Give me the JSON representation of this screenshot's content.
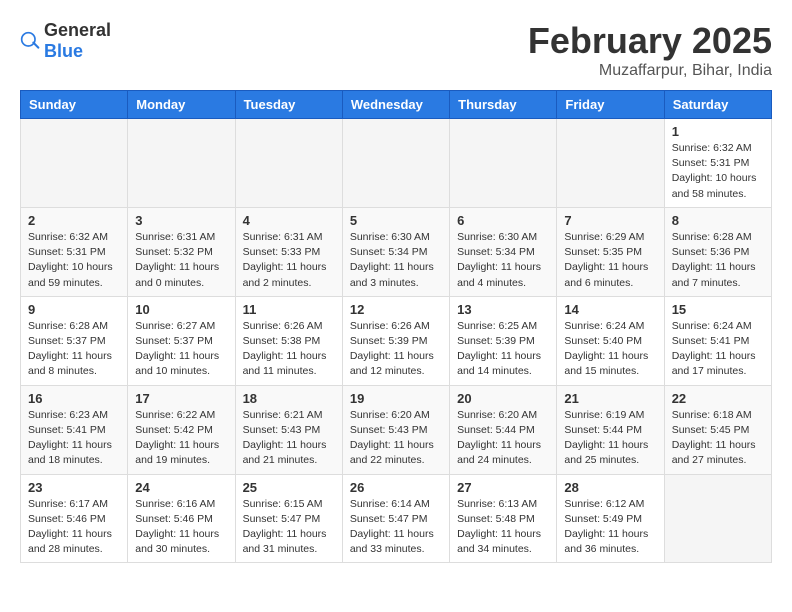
{
  "header": {
    "logo_general": "General",
    "logo_blue": "Blue",
    "title": "February 2025",
    "subtitle": "Muzaffarpur, Bihar, India"
  },
  "calendar": {
    "weekdays": [
      "Sunday",
      "Monday",
      "Tuesday",
      "Wednesday",
      "Thursday",
      "Friday",
      "Saturday"
    ],
    "weeks": [
      [
        {
          "day": "",
          "info": ""
        },
        {
          "day": "",
          "info": ""
        },
        {
          "day": "",
          "info": ""
        },
        {
          "day": "",
          "info": ""
        },
        {
          "day": "",
          "info": ""
        },
        {
          "day": "",
          "info": ""
        },
        {
          "day": "1",
          "info": "Sunrise: 6:32 AM\nSunset: 5:31 PM\nDaylight: 10 hours\nand 58 minutes."
        }
      ],
      [
        {
          "day": "2",
          "info": "Sunrise: 6:32 AM\nSunset: 5:31 PM\nDaylight: 10 hours\nand 59 minutes."
        },
        {
          "day": "3",
          "info": "Sunrise: 6:31 AM\nSunset: 5:32 PM\nDaylight: 11 hours\nand 0 minutes."
        },
        {
          "day": "4",
          "info": "Sunrise: 6:31 AM\nSunset: 5:33 PM\nDaylight: 11 hours\nand 2 minutes."
        },
        {
          "day": "5",
          "info": "Sunrise: 6:30 AM\nSunset: 5:34 PM\nDaylight: 11 hours\nand 3 minutes."
        },
        {
          "day": "6",
          "info": "Sunrise: 6:30 AM\nSunset: 5:34 PM\nDaylight: 11 hours\nand 4 minutes."
        },
        {
          "day": "7",
          "info": "Sunrise: 6:29 AM\nSunset: 5:35 PM\nDaylight: 11 hours\nand 6 minutes."
        },
        {
          "day": "8",
          "info": "Sunrise: 6:28 AM\nSunset: 5:36 PM\nDaylight: 11 hours\nand 7 minutes."
        }
      ],
      [
        {
          "day": "9",
          "info": "Sunrise: 6:28 AM\nSunset: 5:37 PM\nDaylight: 11 hours\nand 8 minutes."
        },
        {
          "day": "10",
          "info": "Sunrise: 6:27 AM\nSunset: 5:37 PM\nDaylight: 11 hours\nand 10 minutes."
        },
        {
          "day": "11",
          "info": "Sunrise: 6:26 AM\nSunset: 5:38 PM\nDaylight: 11 hours\nand 11 minutes."
        },
        {
          "day": "12",
          "info": "Sunrise: 6:26 AM\nSunset: 5:39 PM\nDaylight: 11 hours\nand 12 minutes."
        },
        {
          "day": "13",
          "info": "Sunrise: 6:25 AM\nSunset: 5:39 PM\nDaylight: 11 hours\nand 14 minutes."
        },
        {
          "day": "14",
          "info": "Sunrise: 6:24 AM\nSunset: 5:40 PM\nDaylight: 11 hours\nand 15 minutes."
        },
        {
          "day": "15",
          "info": "Sunrise: 6:24 AM\nSunset: 5:41 PM\nDaylight: 11 hours\nand 17 minutes."
        }
      ],
      [
        {
          "day": "16",
          "info": "Sunrise: 6:23 AM\nSunset: 5:41 PM\nDaylight: 11 hours\nand 18 minutes."
        },
        {
          "day": "17",
          "info": "Sunrise: 6:22 AM\nSunset: 5:42 PM\nDaylight: 11 hours\nand 19 minutes."
        },
        {
          "day": "18",
          "info": "Sunrise: 6:21 AM\nSunset: 5:43 PM\nDaylight: 11 hours\nand 21 minutes."
        },
        {
          "day": "19",
          "info": "Sunrise: 6:20 AM\nSunset: 5:43 PM\nDaylight: 11 hours\nand 22 minutes."
        },
        {
          "day": "20",
          "info": "Sunrise: 6:20 AM\nSunset: 5:44 PM\nDaylight: 11 hours\nand 24 minutes."
        },
        {
          "day": "21",
          "info": "Sunrise: 6:19 AM\nSunset: 5:44 PM\nDaylight: 11 hours\nand 25 minutes."
        },
        {
          "day": "22",
          "info": "Sunrise: 6:18 AM\nSunset: 5:45 PM\nDaylight: 11 hours\nand 27 minutes."
        }
      ],
      [
        {
          "day": "23",
          "info": "Sunrise: 6:17 AM\nSunset: 5:46 PM\nDaylight: 11 hours\nand 28 minutes."
        },
        {
          "day": "24",
          "info": "Sunrise: 6:16 AM\nSunset: 5:46 PM\nDaylight: 11 hours\nand 30 minutes."
        },
        {
          "day": "25",
          "info": "Sunrise: 6:15 AM\nSunset: 5:47 PM\nDaylight: 11 hours\nand 31 minutes."
        },
        {
          "day": "26",
          "info": "Sunrise: 6:14 AM\nSunset: 5:47 PM\nDaylight: 11 hours\nand 33 minutes."
        },
        {
          "day": "27",
          "info": "Sunrise: 6:13 AM\nSunset: 5:48 PM\nDaylight: 11 hours\nand 34 minutes."
        },
        {
          "day": "28",
          "info": "Sunrise: 6:12 AM\nSunset: 5:49 PM\nDaylight: 11 hours\nand 36 minutes."
        },
        {
          "day": "",
          "info": ""
        }
      ]
    ]
  }
}
